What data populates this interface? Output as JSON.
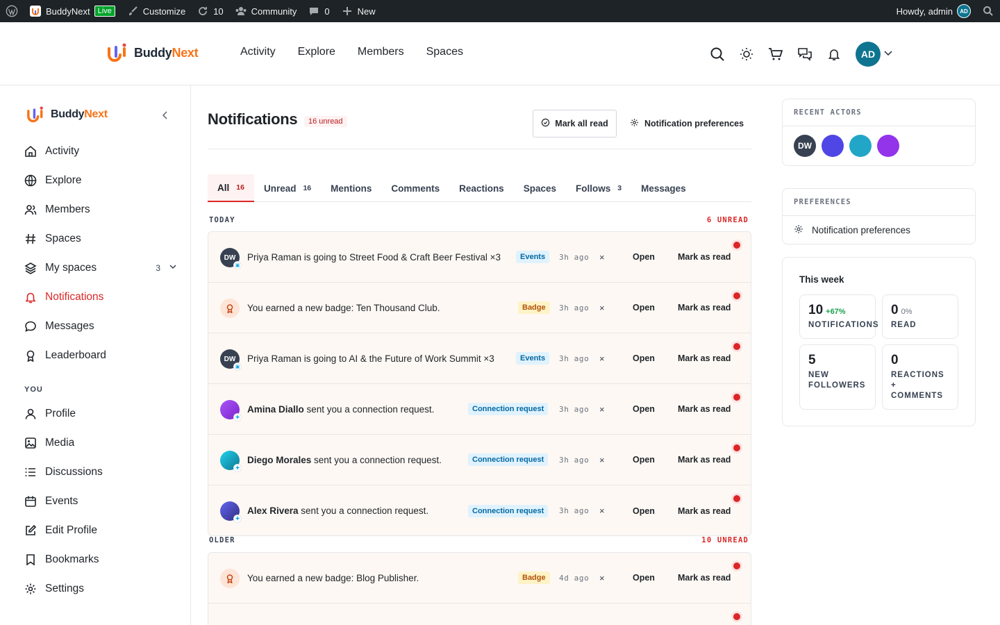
{
  "adminbar": {
    "site_name": "BuddyNext",
    "live_label": "Live",
    "customize": "Customize",
    "updates_count": "10",
    "community": "Community",
    "comments_count": "0",
    "new": "New",
    "howdy": "Howdy, admin",
    "avatar_initials": "AD"
  },
  "header": {
    "logo_part1": "Buddy",
    "logo_part2": "Next",
    "menu": [
      "Activity",
      "Explore",
      "Members",
      "Spaces"
    ],
    "avatar_initials": "AD"
  },
  "sidebar": {
    "logo_part1": "Buddy",
    "logo_part2": "Next",
    "items": [
      {
        "label": "Activity",
        "icon": "home-icon"
      },
      {
        "label": "Explore",
        "icon": "globe-icon"
      },
      {
        "label": "Members",
        "icon": "users-icon"
      },
      {
        "label": "Spaces",
        "icon": "hash-icon"
      },
      {
        "label": "My spaces",
        "icon": "layers-icon",
        "count": "3"
      },
      {
        "label": "Notifications",
        "icon": "bell-icon",
        "active": true
      },
      {
        "label": "Messages",
        "icon": "chat-icon"
      },
      {
        "label": "Leaderboard",
        "icon": "medal-icon"
      }
    ],
    "you_label": "YOU",
    "you_items": [
      {
        "label": "Profile",
        "icon": "user-icon"
      },
      {
        "label": "Media",
        "icon": "image-icon"
      },
      {
        "label": "Discussions",
        "icon": "list-icon"
      },
      {
        "label": "Events",
        "icon": "calendar-icon"
      },
      {
        "label": "Edit Profile",
        "icon": "edit-icon"
      },
      {
        "label": "Bookmarks",
        "icon": "bookmark-icon"
      },
      {
        "label": "Settings",
        "icon": "gear-icon"
      }
    ]
  },
  "main": {
    "title": "Notifications",
    "unread_pill": "16 unread",
    "mark_all_read": "Mark all read",
    "notification_preferences": "Notification preferences",
    "tabs": [
      {
        "label": "All",
        "count": "16",
        "active": true
      },
      {
        "label": "Unread",
        "count": "16"
      },
      {
        "label": "Mentions",
        "count": ""
      },
      {
        "label": "Comments",
        "count": ""
      },
      {
        "label": "Reactions",
        "count": ""
      },
      {
        "label": "Spaces",
        "count": ""
      },
      {
        "label": "Follows",
        "count": "3"
      },
      {
        "label": "Messages",
        "count": ""
      }
    ],
    "today_label": "TODAY",
    "today_unread": "6 UNREAD",
    "older_label": "OLDER",
    "older_unread": "10 UNREAD",
    "open_label": "Open",
    "mark_read_label": "Mark as read",
    "dismiss_label": "×",
    "today": [
      {
        "avatar": "dw",
        "initials": "DW",
        "actor": "",
        "text": "Priya Raman is going to Street Food & Craft Beer Festival ×3",
        "tag": "Events",
        "tag_type": "events",
        "time": "3h ago"
      },
      {
        "avatar": "badge",
        "initials": "",
        "actor": "",
        "text": "You earned a new badge: Ten Thousand Club.",
        "tag": "Badge",
        "tag_type": "badge",
        "time": "3h ago"
      },
      {
        "avatar": "dw",
        "initials": "DW",
        "actor": "",
        "text": "Priya Raman is going to AI & the Future of Work Summit ×3",
        "tag": "Events",
        "tag_type": "events",
        "time": "3h ago"
      },
      {
        "avatar": "amina",
        "initials": "",
        "actor": "Amina Diallo",
        "text": " sent you a connection request.",
        "tag": "Connection request",
        "tag_type": "conn",
        "time": "3h ago"
      },
      {
        "avatar": "diego",
        "initials": "",
        "actor": "Diego Morales",
        "text": " sent you a connection request.",
        "tag": "Connection request",
        "tag_type": "conn",
        "time": "3h ago"
      },
      {
        "avatar": "alex",
        "initials": "",
        "actor": "Alex Rivera",
        "text": " sent you a connection request.",
        "tag": "Connection request",
        "tag_type": "conn",
        "time": "3h ago"
      }
    ],
    "older": [
      {
        "avatar": "badge",
        "initials": "",
        "actor": "",
        "text": "You earned a new badge: Blog Publisher.",
        "tag": "Badge",
        "tag_type": "badge",
        "time": "4d ago"
      }
    ]
  },
  "right": {
    "recent_actors_title": "RECENT ACTORS",
    "actors": [
      {
        "initials": "DW",
        "color": "#374151"
      },
      {
        "initials": "",
        "color": "#4f46e5"
      },
      {
        "initials": "",
        "color": "#22a6c7"
      },
      {
        "initials": "",
        "color": "#9333ea"
      }
    ],
    "preferences_title": "PREFERENCES",
    "preferences_link": "Notification preferences",
    "week_title": "This week",
    "stats": [
      {
        "num": "10",
        "delta": "+67%",
        "label": "NOTIFICATIONS"
      },
      {
        "num": "0",
        "delta": "0%",
        "label": "READ"
      },
      {
        "num": "5",
        "delta": "",
        "label": "NEW FOLLOWERS"
      },
      {
        "num": "0",
        "delta": "",
        "label": "REACTIONS + COMMENTS"
      }
    ]
  },
  "colors": {
    "accent": "#dc2626",
    "brand_orange": "#f97316",
    "avatar_teal": "#0e7490"
  }
}
